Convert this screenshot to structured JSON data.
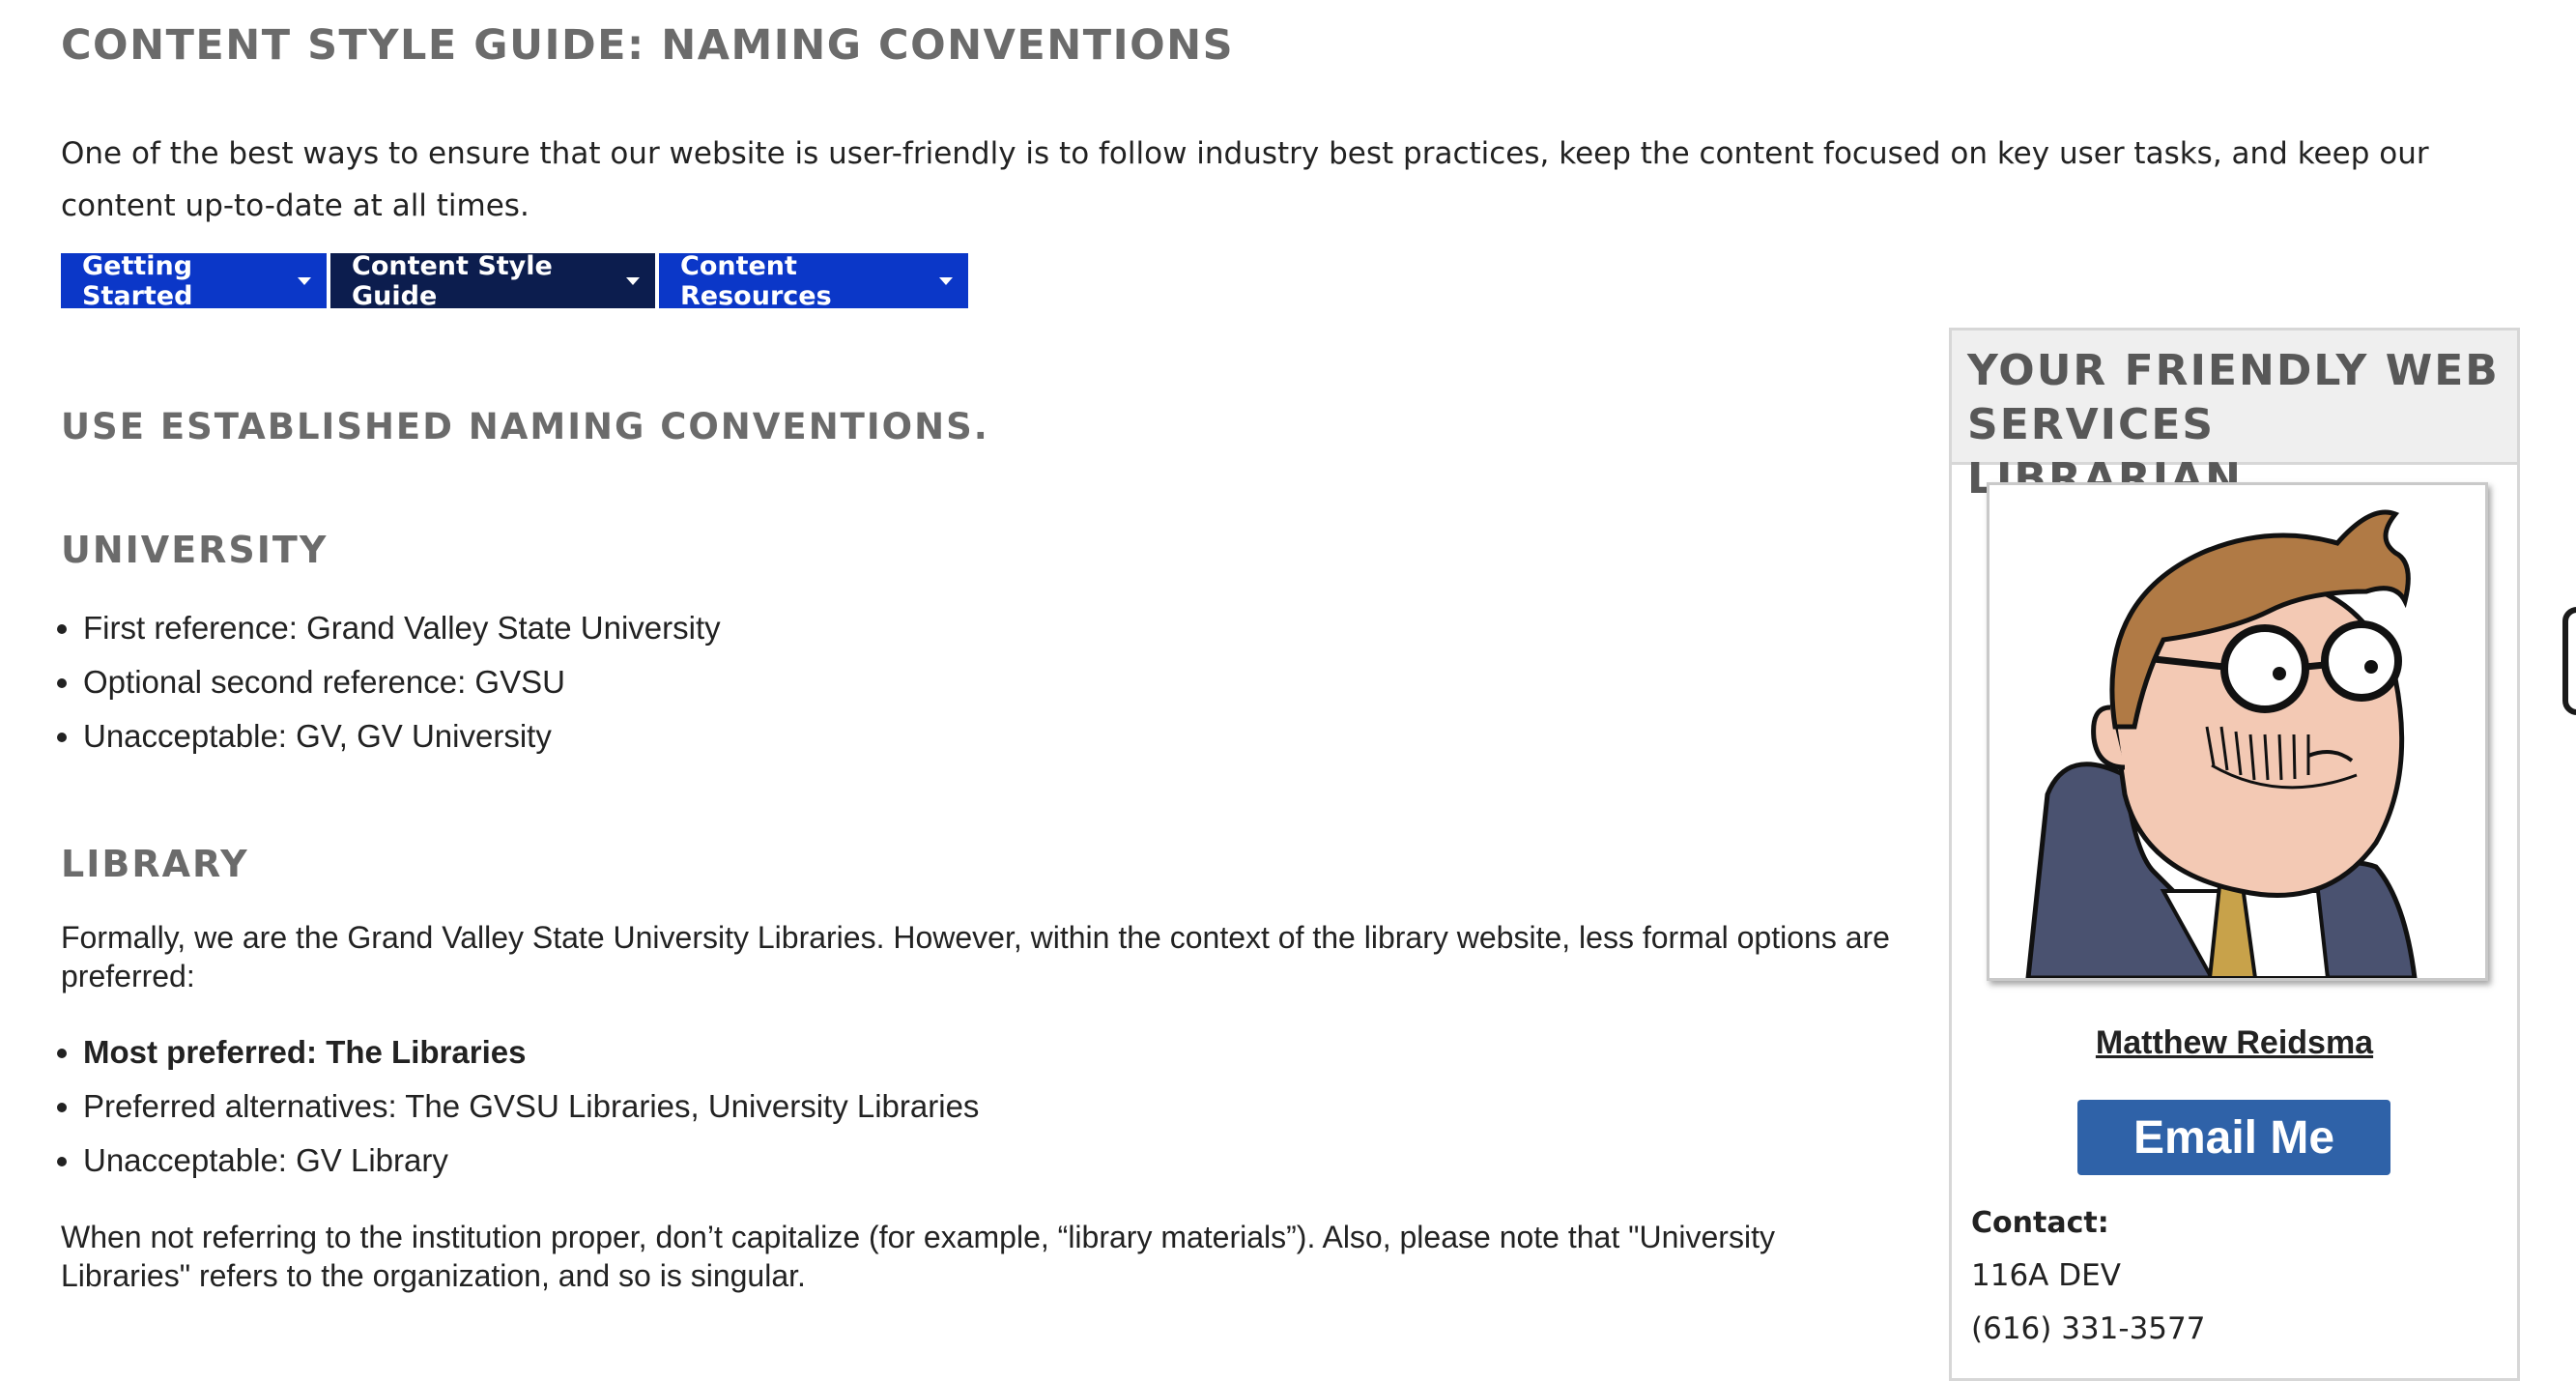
{
  "page": {
    "title": "CONTENT STYLE GUIDE: NAMING CONVENTIONS",
    "intro": "One of the best ways to ensure that our website is user-friendly is to follow industry best practices, keep the content focused on key user tasks, and keep our content up-to-date at all times."
  },
  "tabs": [
    {
      "label": "Getting Started",
      "active": false
    },
    {
      "label": "Content Style Guide",
      "active": true
    },
    {
      "label": "Content Resources",
      "active": false
    }
  ],
  "main": {
    "section_heading": "USE ESTABLISHED NAMING CONVENTIONS.",
    "university": {
      "heading": "UNIVERSITY",
      "items": [
        "First reference: Grand Valley State University",
        "Optional second reference: GVSU",
        "Unacceptable: GV, GV University"
      ]
    },
    "library": {
      "heading": "LIBRARY",
      "intro": "Formally, we are the Grand Valley State University Libraries. However, within the context of the library website, less formal options are preferred:",
      "items": [
        "Most preferred: The Libraries",
        "Preferred alternatives: The GVSU Libraries, University Libraries",
        "Unacceptable: GV Library"
      ],
      "note": "When not referring to the institution proper, don’t capitalize (for example, “library materials”). Also, please note that \"University Libraries\" refers to the organization, and so is singular."
    }
  },
  "sidebar": {
    "title": "YOUR FRIENDLY WEB SERVICES LIBRARIAN",
    "name": "Matthew Reidsma",
    "email_label": "Email Me",
    "contact_label": "Contact:",
    "office": "116A DEV",
    "phone": "(616) 331-3577"
  },
  "colors": {
    "tab_blue": "#0b37c8",
    "tab_active": "#0c1d4e",
    "email_button": "#2f62a8",
    "heading_gray": "#6b6b6b"
  },
  "icons": [
    "caret-down-icon",
    "librarian-portrait"
  ]
}
